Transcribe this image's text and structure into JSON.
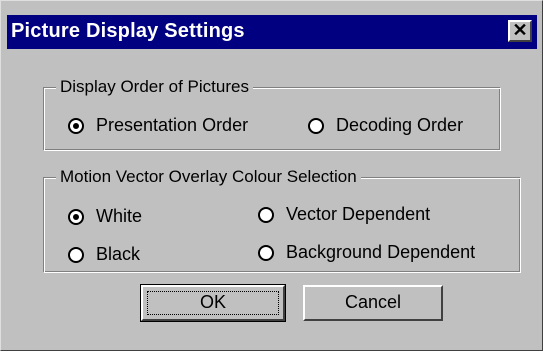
{
  "window": {
    "title": "Picture Display Settings",
    "close_glyph": "✕"
  },
  "display_order": {
    "label": "Display Order of Pictures",
    "options": [
      {
        "label": "Presentation Order",
        "checked": true
      },
      {
        "label": "Decoding Order",
        "checked": false
      }
    ]
  },
  "overlay_colour": {
    "label": "Motion Vector Overlay Colour Selection",
    "options": [
      {
        "label": "White",
        "checked": true
      },
      {
        "label": "Black",
        "checked": false
      },
      {
        "label": "Vector Dependent",
        "checked": false
      },
      {
        "label": "Background Dependent",
        "checked": false
      }
    ]
  },
  "buttons": {
    "ok": "OK",
    "cancel": "Cancel"
  }
}
